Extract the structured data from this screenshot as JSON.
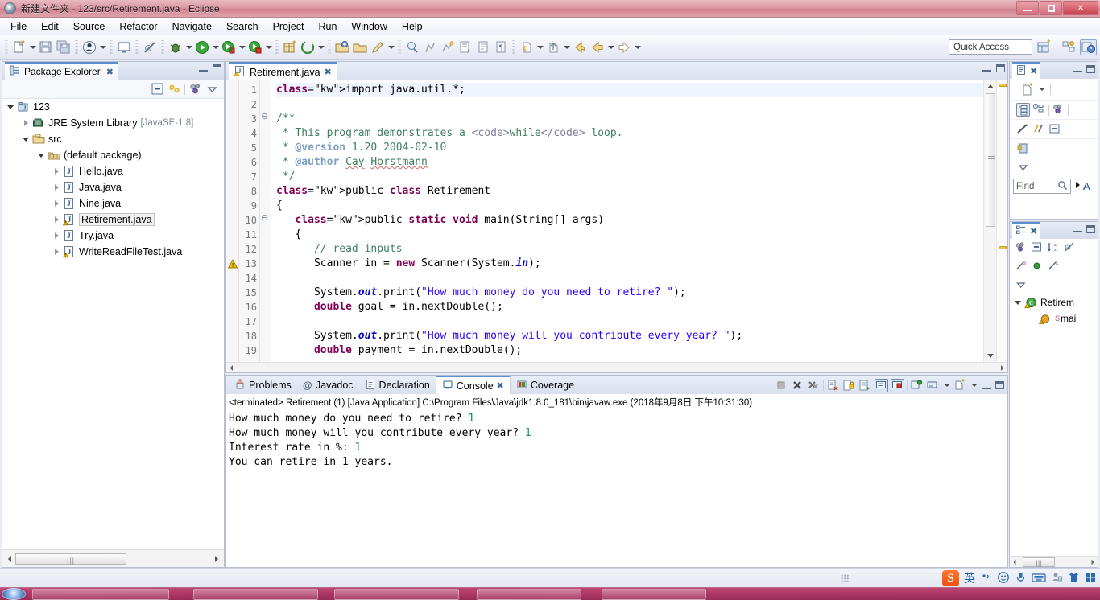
{
  "window": {
    "title": "新建文件夹 - 123/src/Retirement.java - Eclipse",
    "app_icon": "eclipse-icon",
    "minimize": "–",
    "maximize": "□",
    "close": "✕"
  },
  "menubar": {
    "items": [
      {
        "label": "File",
        "mnemonic": "F"
      },
      {
        "label": "Edit",
        "mnemonic": "E"
      },
      {
        "label": "Source",
        "mnemonic": "S"
      },
      {
        "label": "Refactor",
        "mnemonic": "t"
      },
      {
        "label": "Navigate",
        "mnemonic": "N"
      },
      {
        "label": "Search",
        "mnemonic": "a"
      },
      {
        "label": "Project",
        "mnemonic": "P"
      },
      {
        "label": "Run",
        "mnemonic": "R"
      },
      {
        "label": "Window",
        "mnemonic": "W"
      },
      {
        "label": "Help",
        "mnemonic": "H"
      }
    ]
  },
  "toolbar": {
    "quick_access_placeholder": "Quick Access",
    "icons": [
      "new-wizard-icon",
      "save-icon",
      "save-all-icon",
      "user-icon",
      "console-icon",
      "skip-breakpoints-icon",
      "debug-icon",
      "run-icon",
      "coverage-icon",
      "coverage-stop-icon",
      "new-java-package-icon",
      "external-tools-icon",
      "open-type-icon",
      "open-task-icon",
      "pencil-icon",
      "search-icon",
      "annotation-icon",
      "next-annotation-icon",
      "prev-edit-icon",
      "last-edit-icon",
      "back-icon",
      "forward-icon"
    ],
    "perspective_icons": [
      "open-perspective-icon",
      "java-ee-perspective-icon",
      "java-perspective-icon"
    ]
  },
  "package_explorer": {
    "tab_label": "Package Explorer",
    "tab_icon": "package-explorer-icon",
    "toolbar_icons": [
      "collapse-all-icon",
      "link-with-editor-icon",
      "view-menu-filters-icon",
      "view-menu-icon"
    ],
    "tree": [
      {
        "label": "123",
        "icon": "java-project-icon",
        "indent": 0,
        "twisty": "open",
        "sub": "",
        "selected": false
      },
      {
        "label": "JRE System Library",
        "icon": "library-icon",
        "indent": 1,
        "twisty": "closed",
        "sub": "[JavaSE-1.8]",
        "selected": false
      },
      {
        "label": "src",
        "icon": "source-folder-icon",
        "indent": 1,
        "twisty": "open",
        "sub": "",
        "selected": false
      },
      {
        "label": "(default package)",
        "icon": "package-icon",
        "indent": 2,
        "twisty": "open",
        "sub": "",
        "selected": false
      },
      {
        "label": "Hello.java",
        "icon": "java-file-icon",
        "indent": 3,
        "twisty": "closed",
        "sub": "",
        "selected": false
      },
      {
        "label": "Java.java",
        "icon": "java-file-icon",
        "indent": 3,
        "twisty": "closed",
        "sub": "",
        "selected": false
      },
      {
        "label": "Nine.java",
        "icon": "java-file-icon",
        "indent": 3,
        "twisty": "closed",
        "sub": "",
        "selected": false
      },
      {
        "label": "Retirement.java",
        "icon": "java-file-warning-icon",
        "indent": 3,
        "twisty": "closed",
        "sub": "",
        "selected": true
      },
      {
        "label": "Try.java",
        "icon": "java-file-icon",
        "indent": 3,
        "twisty": "closed",
        "sub": "",
        "selected": false
      },
      {
        "label": "WriteReadFileTest.java",
        "icon": "java-file-warning-icon",
        "indent": 3,
        "twisty": "closed",
        "sub": "",
        "selected": false
      }
    ]
  },
  "editor": {
    "tab_label": "Retirement.java",
    "tab_icon": "java-file-warning-icon",
    "tab_close": "╳",
    "ctrl_minimize": "minimize-icon",
    "ctrl_maximize": "maximize-icon",
    "lines": [
      {
        "n": 1,
        "fold": false,
        "marker": "",
        "highlight": true
      },
      {
        "n": 2,
        "fold": false,
        "marker": "",
        "highlight": false
      },
      {
        "n": 3,
        "fold": true,
        "marker": "",
        "highlight": false
      },
      {
        "n": 4,
        "fold": false,
        "marker": "",
        "highlight": false
      },
      {
        "n": 5,
        "fold": false,
        "marker": "",
        "highlight": false
      },
      {
        "n": 6,
        "fold": false,
        "marker": "",
        "highlight": false
      },
      {
        "n": 7,
        "fold": false,
        "marker": "",
        "highlight": false
      },
      {
        "n": 8,
        "fold": false,
        "marker": "",
        "highlight": false
      },
      {
        "n": 9,
        "fold": false,
        "marker": "",
        "highlight": false
      },
      {
        "n": 10,
        "fold": true,
        "marker": "",
        "highlight": false
      },
      {
        "n": 11,
        "fold": false,
        "marker": "",
        "highlight": false
      },
      {
        "n": 12,
        "fold": false,
        "marker": "",
        "highlight": false
      },
      {
        "n": 13,
        "fold": false,
        "marker": "warning",
        "highlight": false
      },
      {
        "n": 14,
        "fold": false,
        "marker": "",
        "highlight": false
      },
      {
        "n": 15,
        "fold": false,
        "marker": "",
        "highlight": false
      },
      {
        "n": 16,
        "fold": false,
        "marker": "",
        "highlight": false
      },
      {
        "n": 17,
        "fold": false,
        "marker": "",
        "highlight": false
      },
      {
        "n": 18,
        "fold": false,
        "marker": "",
        "highlight": false
      },
      {
        "n": 19,
        "fold": false,
        "marker": "",
        "highlight": false
      }
    ],
    "code": [
      "import java.util.*;",
      "",
      "/**",
      " * This program demonstrates a <code>while</code> loop.",
      " * @version 1.20 2004-02-10",
      " * @author Cay Horstmann",
      " */",
      "public class Retirement",
      "{",
      "   public static void main(String[] args)",
      "   {",
      "      // read inputs",
      "      Scanner in = new Scanner(System.in);",
      "",
      "      System.out.print(\"How much money do you need to retire? \");",
      "      double goal = in.nextDouble();",
      "",
      "      System.out.print(\"How much money will you contribute every year? \");",
      "      double payment = in.nextDouble();"
    ]
  },
  "bottom_panel": {
    "tabs": [
      {
        "label": "Problems",
        "icon": "problems-icon",
        "active": false
      },
      {
        "label": "Javadoc",
        "icon": "javadoc-icon",
        "active": false
      },
      {
        "label": "Declaration",
        "icon": "declaration-icon",
        "active": false
      },
      {
        "label": "Console",
        "icon": "console-icon",
        "active": true,
        "close": "╳"
      },
      {
        "label": "Coverage",
        "icon": "coverage-icon",
        "active": false
      }
    ],
    "toolbar_icons": [
      "terminate-icon",
      "remove-launch-icon",
      "remove-all-terminated-icon",
      "clear-console-icon",
      "scroll-lock-icon",
      "word-wrap-icon",
      "show-console-on-output-icon",
      "pin-console-icon",
      "display-selected-console-icon",
      "open-console-icon",
      "console-menu-icon"
    ],
    "ctrl_minimize": "minimize-icon",
    "ctrl_maximize": "maximize-icon"
  },
  "console": {
    "header": "<terminated> Retirement (1) [Java Application] C:\\Program Files\\Java\\jdk1.8.0_181\\bin\\javaw.exe (2018年9月8日 下午10:31:30)",
    "lines": [
      {
        "prompt": "How much money do you need to retire? ",
        "input": "1"
      },
      {
        "prompt": "How much money will you contribute every year? ",
        "input": "1"
      },
      {
        "prompt": "Interest rate in %: ",
        "input": "1"
      },
      {
        "prompt": "You can retire in 1 years.",
        "input": ""
      }
    ],
    "input_color": "#0a9a4a",
    "output_color": "#000000"
  },
  "task_list": {
    "tab_label": "",
    "tab_icon": "task-list-icon",
    "tab_close": "╳",
    "new_task_icon": "new-task-icon",
    "toolbar_icons": [
      "categorized-presentation-icon",
      "scheduled-presentation-icon",
      "focus-on-workweek-icon",
      "synchronize-changed-icon",
      "collapse-all-icon",
      "view-menu-icon"
    ],
    "find_placeholder": "Find",
    "find_icon": "search-icon",
    "find_next_icon": "next-icon",
    "find_all_label": "A"
  },
  "outline": {
    "tab_icon": "outline-icon",
    "tab_close": "╳",
    "toolbar_icons": [
      "hide-fields-icon",
      "collapse-all-icon",
      "sort-icon",
      "hide-static-icon",
      "hide-nonpublic-icon",
      "show-all-icon",
      "hide-local-types-icon",
      "view-menu-icon"
    ],
    "items": [
      {
        "label": "Retirem",
        "icon": "class-warning-icon",
        "indent": 0,
        "twisty": "open",
        "badge": ""
      },
      {
        "label": "mai",
        "icon": "method-warning-icon",
        "indent": 1,
        "twisty": "none",
        "badge": "S"
      }
    ]
  },
  "statusbar": {
    "resize_grip": "resize-grip",
    "ime": {
      "logo": "S",
      "mode": "英",
      "icons": [
        "punctuation-icon",
        "emoji-icon",
        "voice-input-icon",
        "soft-keyboard-icon",
        "user-icon",
        "skin-icon",
        "toolbox-icon"
      ]
    }
  },
  "taskbar": {
    "start_icon": "windows-start-orb",
    "items": [
      "taskbar-item-1",
      "taskbar-item-2",
      "taskbar-item-3",
      "taskbar-item-4",
      "taskbar-item-5"
    ]
  }
}
